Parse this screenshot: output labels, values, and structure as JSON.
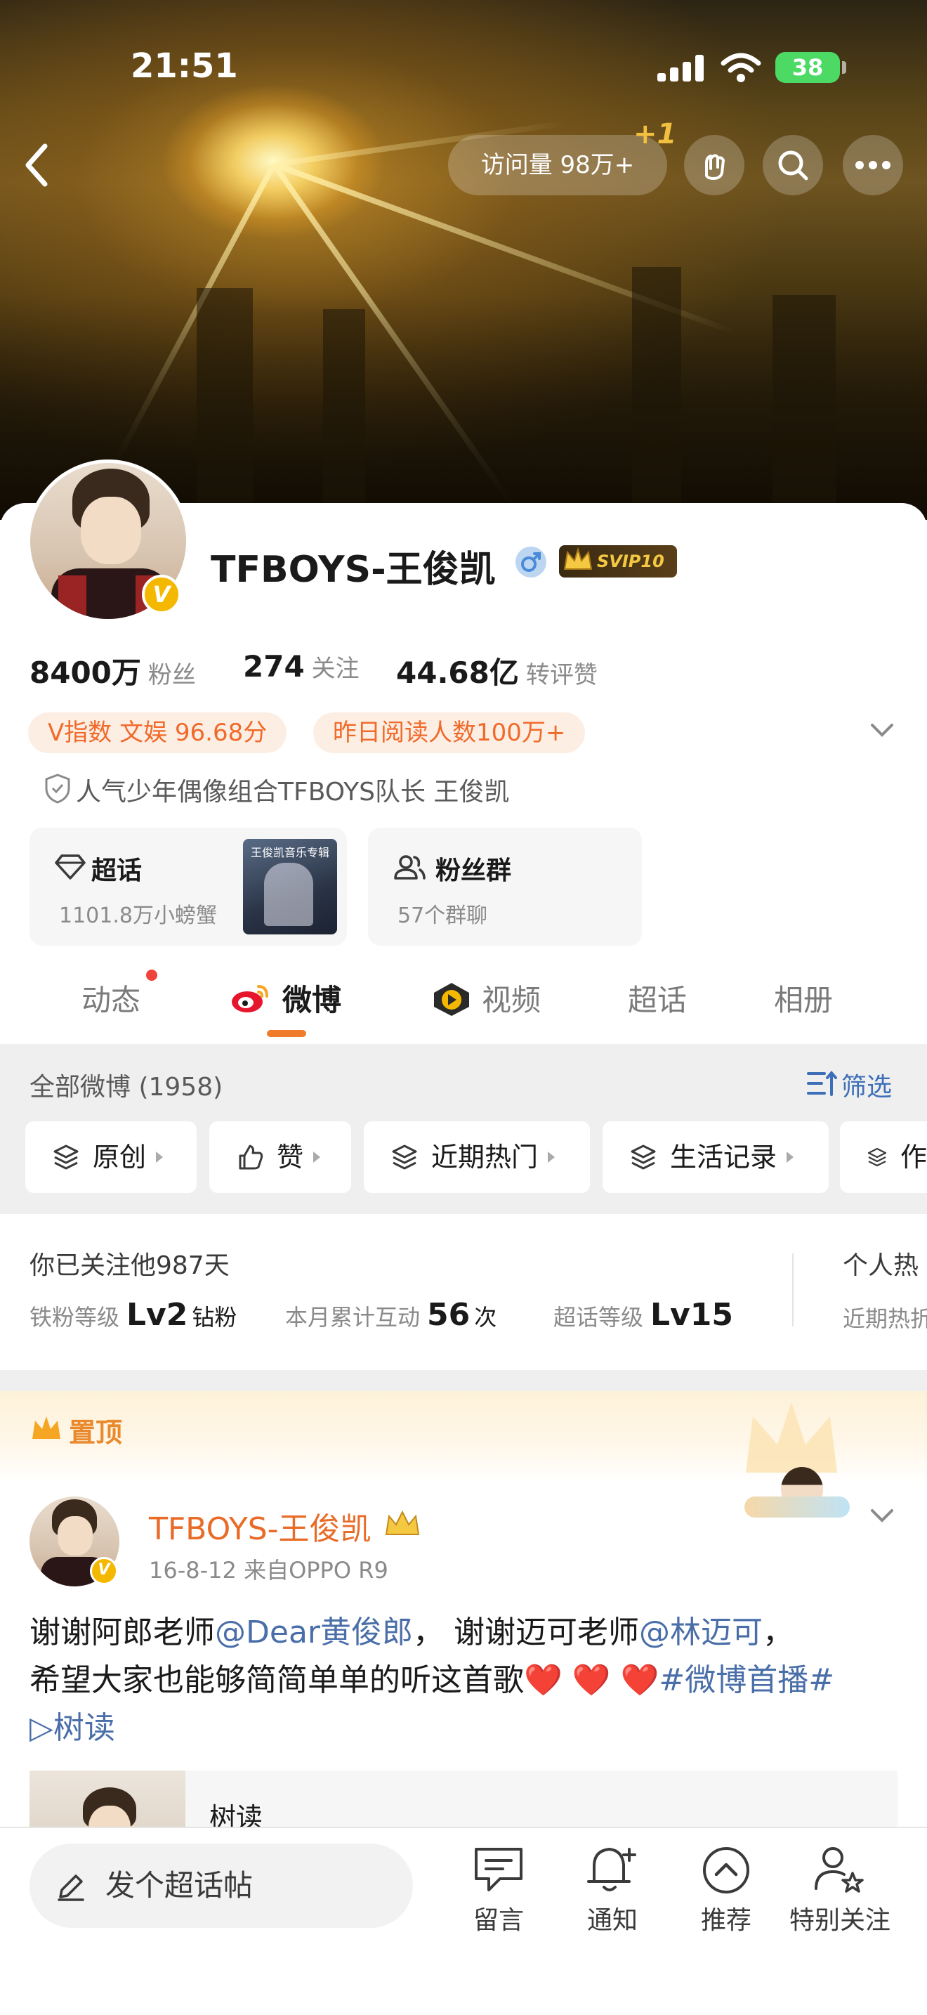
{
  "status_bar": {
    "time": "21:51",
    "battery": "38"
  },
  "header": {
    "visits": "访问量 98万+",
    "plus_one": "+1"
  },
  "profile": {
    "name": "TFBOYS-王俊凯",
    "vip_badge": "SVIP10",
    "stats": [
      {
        "value": "8400万",
        "label": "粉丝"
      },
      {
        "value": "274",
        "label": "关注"
      },
      {
        "value": "44.68亿",
        "label": "转评赞"
      }
    ],
    "tags": [
      "V指数 文娱 96.68分",
      "昨日阅读人数100万+"
    ],
    "intro": "人气少年偶像组合TFBOYS队长 王俊凯",
    "supertopic": {
      "title": "超话",
      "sub": "1101.8万小螃蟹",
      "cover_text": "王俊凯音乐专辑"
    },
    "fan_group": {
      "title": "粉丝群",
      "sub": "57个群聊"
    }
  },
  "tabs": [
    "动态",
    "微博",
    "视频",
    "超话",
    "相册"
  ],
  "filter": {
    "all_label": "全部微博 (1958)",
    "filter_label": "筛选",
    "chips": [
      "原创",
      "赞",
      "近期热门",
      "生活记录",
      "作"
    ]
  },
  "follow_info": {
    "days": "你已关注他987天",
    "levels": [
      {
        "label": "铁粉等级",
        "value": "Lv2",
        "unit": "钻粉"
      },
      {
        "label": "本月累计互动",
        "value": "56",
        "unit": "次"
      },
      {
        "label": "超话等级",
        "value": "Lv15",
        "unit": ""
      }
    ],
    "side_top": "个人热",
    "side_bottom": "近期热折"
  },
  "pinned_label": "置顶",
  "post": {
    "author": "TFBOYS-王俊凯",
    "meta": "16-8-12  来自OPPO R9",
    "text_1": "谢谢阿郎老师",
    "mention_1": "@Dear黄俊郎",
    "text_2": "， 谢谢迈可老师",
    "mention_2": "@林迈可",
    "text_3": "，",
    "text_4": "希望大家也能够简简单单的听这首歌",
    "hearts": "❤️ ❤️ ❤️",
    "hashtag": "#微博首播#",
    "music_link": "▷树读",
    "media_title": "树读"
  },
  "bottom_bar": {
    "compose": "发个超话帖",
    "actions": [
      "留言",
      "通知",
      "推荐",
      "特别关注"
    ]
  },
  "colors": {
    "accent": "#f07b2a",
    "link": "#4a6ea8",
    "name_orange": "#e96b28",
    "gold": "#f5b800"
  }
}
